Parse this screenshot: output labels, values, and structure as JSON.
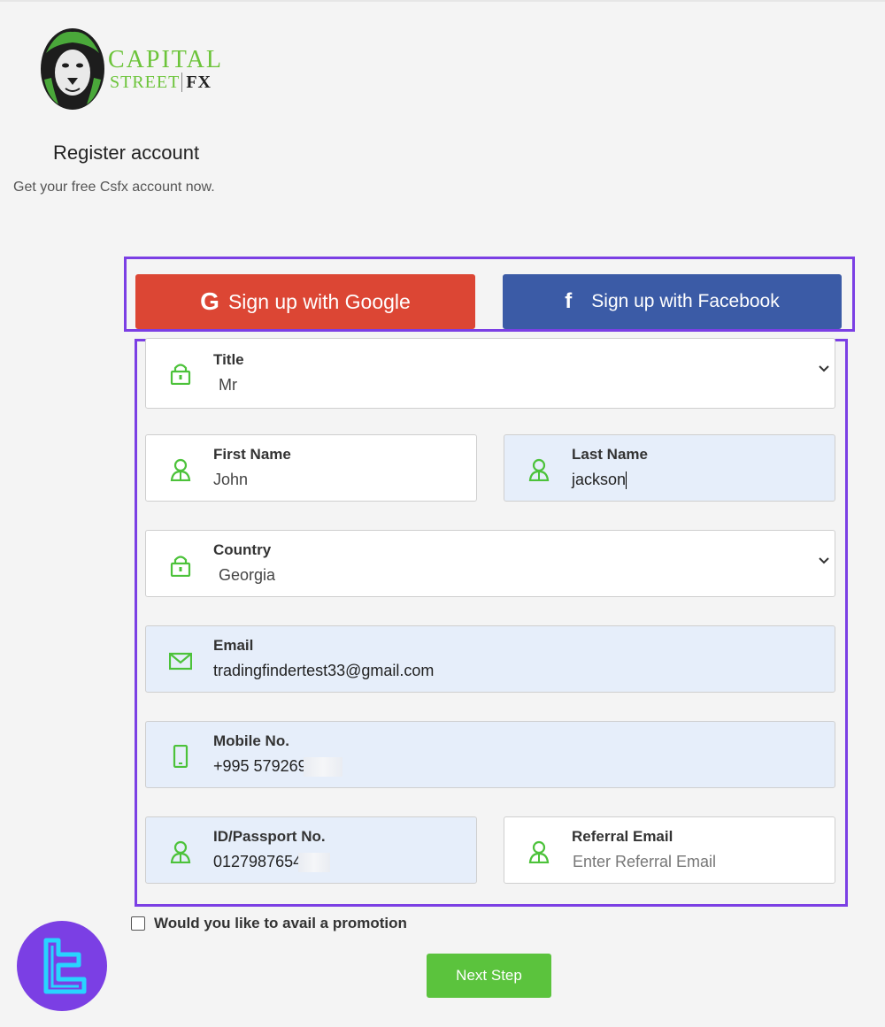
{
  "brand": {
    "line1": "CAPITAL",
    "line2": "STREET",
    "fx": "FX"
  },
  "header": {
    "title": "Register account",
    "subtitle": "Get your free Csfx account now."
  },
  "social": {
    "google_label": "Sign up with Google",
    "facebook_label": "Sign up with Facebook"
  },
  "form": {
    "title": {
      "label": "Title",
      "value": "Mr"
    },
    "first_name": {
      "label": "First Name",
      "value": "John"
    },
    "last_name": {
      "label": "Last Name",
      "value": "jackson"
    },
    "country": {
      "label": "Country",
      "value": "Georgia"
    },
    "email": {
      "label": "Email",
      "value": "tradingfindertest33@gmail.com"
    },
    "mobile": {
      "label": "Mobile No.",
      "value": "+995 579269"
    },
    "id_passport": {
      "label": "ID/Passport No.",
      "value": "0127987654"
    },
    "referral": {
      "label": "Referral Email",
      "placeholder": "Enter Referral Email"
    }
  },
  "promo": {
    "label": "Would you like to avail a promotion"
  },
  "next_button": {
    "label": "Next Step"
  },
  "colors": {
    "accent_green": "#5bc33d",
    "google_red": "#dc4634",
    "facebook_blue": "#3b5ba6",
    "highlight_purple": "#7b3fe4"
  },
  "icons": {
    "lock": "lock-icon",
    "user": "user-icon",
    "mail": "mail-icon",
    "phone": "phone-icon",
    "chevron": "chevron-down-icon"
  }
}
